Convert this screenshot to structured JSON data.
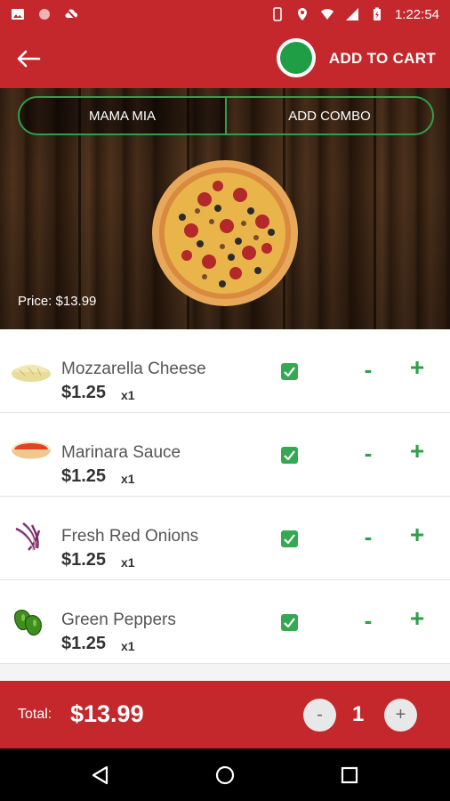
{
  "status_bar": {
    "time": "1:22:54",
    "icons": [
      "image-icon",
      "circle-icon",
      "cloud-off-icon",
      "phone-icon",
      "location-icon",
      "wifi-icon",
      "signal-icon",
      "battery-charging-icon"
    ]
  },
  "app_bar": {
    "back_icon": "arrow-left-icon",
    "add_to_cart_label": "ADD TO CART",
    "cart_indicator_color": "#1f9e45"
  },
  "hero": {
    "tabs": [
      {
        "label": "MAMA MIA",
        "active": true
      },
      {
        "label": "ADD COMBO",
        "active": false
      }
    ],
    "price_label": "Price: $13.99"
  },
  "toppings": [
    {
      "name": "Mozzarella Cheese",
      "price": "$1.25",
      "qty": "x1",
      "checked": true,
      "thumb": "cheese-icon"
    },
    {
      "name": "Marinara Sauce",
      "price": "$1.25",
      "qty": "x1",
      "checked": true,
      "thumb": "sauce-icon"
    },
    {
      "name": "Fresh Red Onions",
      "price": "$1.25",
      "qty": "x1",
      "checked": true,
      "thumb": "onion-icon"
    },
    {
      "name": "Green Peppers",
      "price": "$1.25",
      "qty": "x1",
      "checked": true,
      "thumb": "pepper-icon"
    }
  ],
  "controls": {
    "minus": "-",
    "plus": "+"
  },
  "total_bar": {
    "label": "Total:",
    "value": "$13.99",
    "minus": "-",
    "plus": "+",
    "quantity": "1"
  },
  "colors": {
    "brand_red": "#c4282c",
    "accent_green": "#2ea04a"
  },
  "nav_bar": {
    "buttons": [
      "back-triangle-icon",
      "home-circle-icon",
      "recents-square-icon"
    ]
  }
}
